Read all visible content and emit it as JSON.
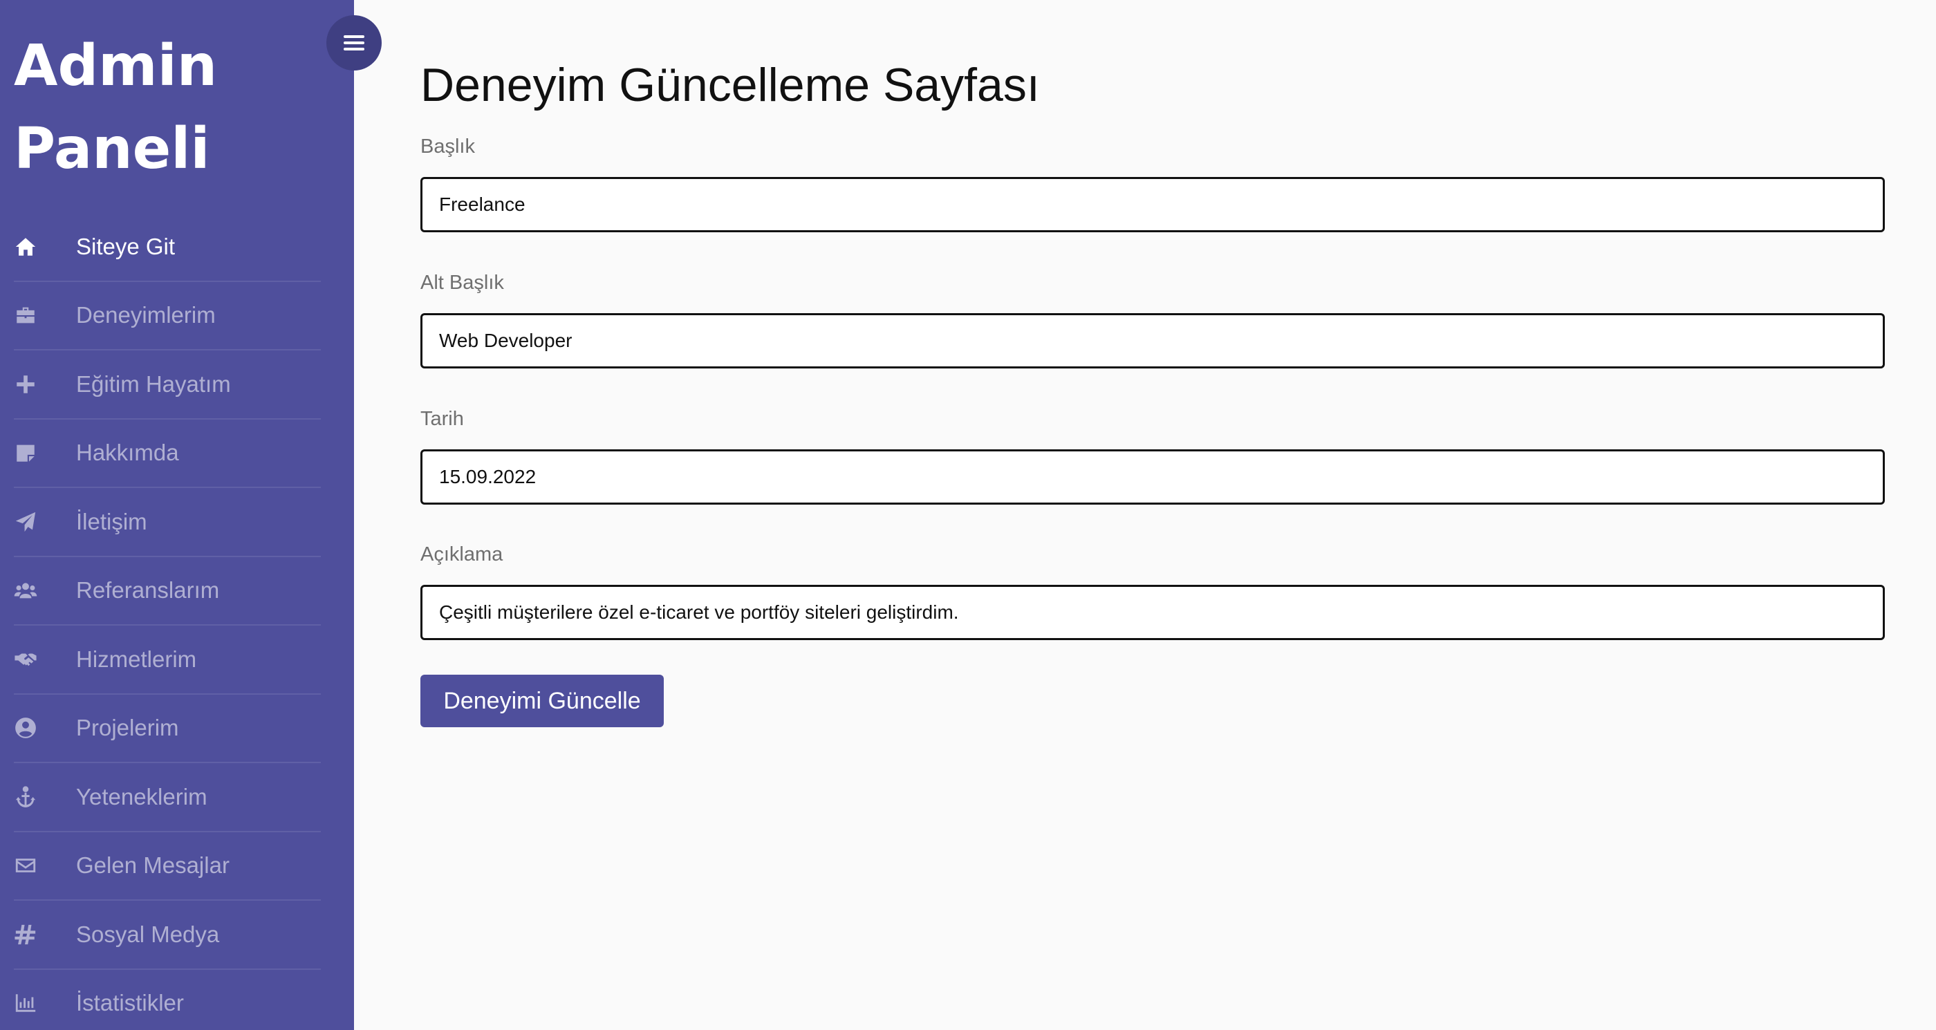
{
  "sidebar": {
    "brand_line1": "Admin",
    "brand_line2": "Paneli",
    "items": [
      {
        "label": "Siteye Git",
        "icon": "home-icon"
      },
      {
        "label": "Deneyimlerim",
        "icon": "briefcase-icon"
      },
      {
        "label": "Eğitim Hayatım",
        "icon": "plus-icon"
      },
      {
        "label": "Hakkımda",
        "icon": "sticky-note-icon"
      },
      {
        "label": "İletişim",
        "icon": "paper-plane-icon"
      },
      {
        "label": "Referanslarım",
        "icon": "users-icon"
      },
      {
        "label": "Hizmetlerim",
        "icon": "handshake-icon"
      },
      {
        "label": "Projelerim",
        "icon": "user-circle-icon"
      },
      {
        "label": "Yeteneklerim",
        "icon": "anchor-icon"
      },
      {
        "label": "Gelen Mesajlar",
        "icon": "envelope-icon"
      },
      {
        "label": "Sosyal Medya",
        "icon": "hashtag-icon"
      },
      {
        "label": "İstatistikler",
        "icon": "bar-chart-icon"
      }
    ],
    "active_item": "Siteye Git"
  },
  "header": {
    "toggle_icon": "bars-icon"
  },
  "main": {
    "title": "Deneyim Güncelleme Sayfası",
    "form": {
      "title_label": "Başlık",
      "title_value": "Freelance",
      "subtitle_label": "Alt Başlık",
      "subtitle_value": "Web Developer",
      "date_label": "Tarih",
      "date_value": "15.09.2022",
      "description_label": "Açıklama",
      "description_value": "Çeşitli müşterilere özel e-ticaret ve portföy siteleri geliştirdim.",
      "submit_label": "Deneyimi Güncelle"
    }
  },
  "colors": {
    "sidebar_bg": "#4f4f9c",
    "toggle_bg": "#3f3f82",
    "accent": "#4f4f9c",
    "page_bg": "#fafafa"
  }
}
